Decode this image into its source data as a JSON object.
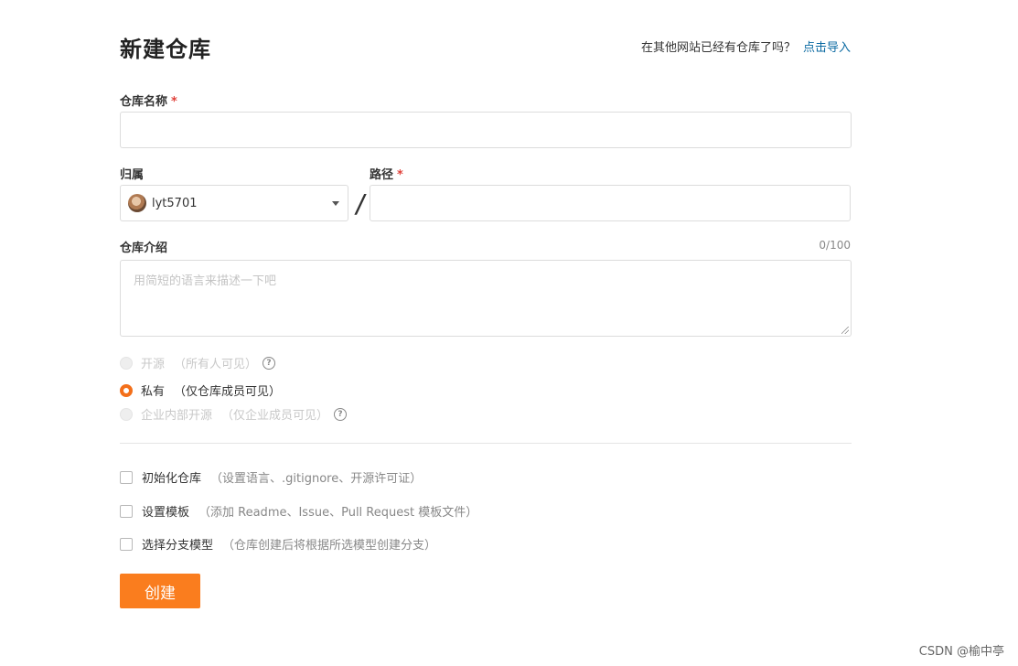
{
  "page_title": "新建仓库",
  "import_hint": {
    "text": "在其他网站已经有仓库了吗？",
    "link": "点击导入"
  },
  "repo_name": {
    "label": "仓库名称",
    "required_mark": "*",
    "value": ""
  },
  "owner": {
    "label": "归属",
    "selected": "lyt5701"
  },
  "path_separator": "/",
  "path": {
    "label": "路径",
    "required_mark": "*",
    "value": ""
  },
  "description": {
    "label": "仓库介绍",
    "counter": "0/100",
    "placeholder": "用简短的语言来描述一下吧"
  },
  "visibility": [
    {
      "label": "开源",
      "hint": "（所有人可见）",
      "checked": false,
      "disabled": true,
      "help": true
    },
    {
      "label": "私有",
      "hint": "（仅仓库成员可见）",
      "checked": true,
      "disabled": false,
      "help": false
    },
    {
      "label": "企业内部开源",
      "hint": "（仅企业成员可见）",
      "checked": false,
      "disabled": true,
      "help": true
    }
  ],
  "options": [
    {
      "label": "初始化仓库",
      "hint": "（设置语言、.gitignore、开源许可证）",
      "checked": false
    },
    {
      "label": "设置模板",
      "hint": "（添加 Readme、Issue、Pull Request 模板文件）",
      "checked": false
    },
    {
      "label": "选择分支模型",
      "hint": "（仓库创建后将根据所选模型创建分支）",
      "checked": false
    }
  ],
  "create_button": "创建",
  "watermark": "CSDN @榆中亭",
  "colors": {
    "accent": "#fa7d1e",
    "link": "#0b6aa2",
    "required": "#e0413a"
  }
}
